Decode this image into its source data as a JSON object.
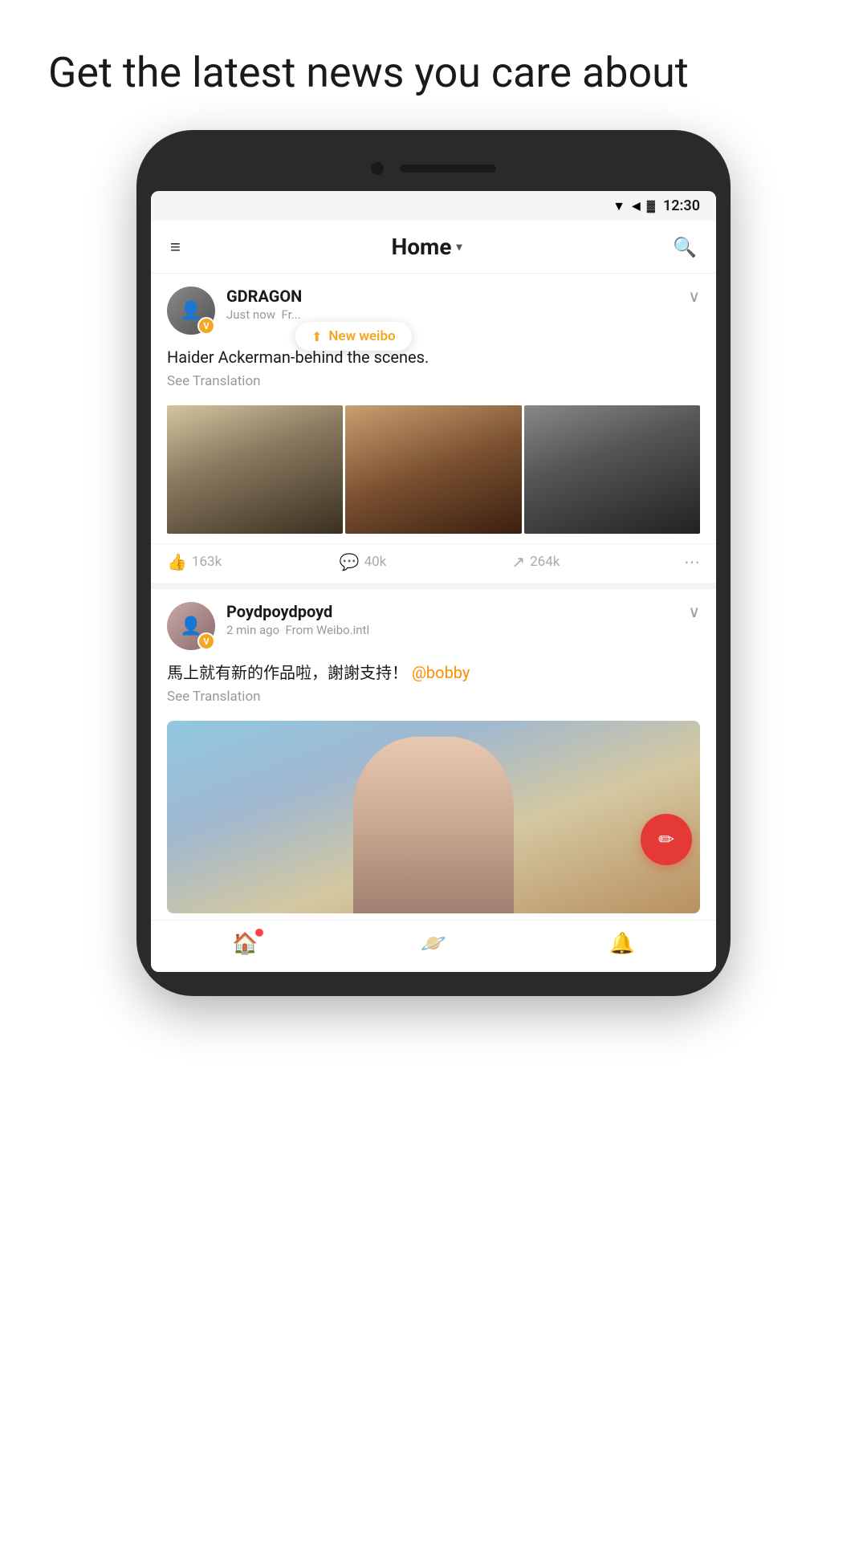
{
  "page": {
    "headline": "Get the latest news you care about"
  },
  "statusBar": {
    "time": "12:30"
  },
  "appHeader": {
    "menu_label": "≡",
    "title": "Home",
    "dropdown_symbol": "▾",
    "search_label": "🔍"
  },
  "newWeiboBadge": {
    "arrow": "⬆",
    "label": "New weibo"
  },
  "posts": [
    {
      "id": "post1",
      "username": "GDRAGON",
      "time": "Just now",
      "source": "Fr...",
      "verified": "V",
      "text": "Haider Ackerman-behind the scenes.",
      "see_translation": "See Translation",
      "likes": "163k",
      "comments": "40k",
      "reposts": "264k"
    },
    {
      "id": "post2",
      "username": "Poydpoydpoyd",
      "time": "2 min ago",
      "source": "From Weibo.intl",
      "verified": "V",
      "text": "馬上就有新的作品啦，謝謝支持！",
      "mention": "@bobby",
      "see_translation": "See Translation"
    }
  ],
  "bottomNav": {
    "home_icon": "🏠",
    "discover_icon": "🪐",
    "notifications_icon": "🔔"
  },
  "fab": {
    "icon": "✏️"
  }
}
